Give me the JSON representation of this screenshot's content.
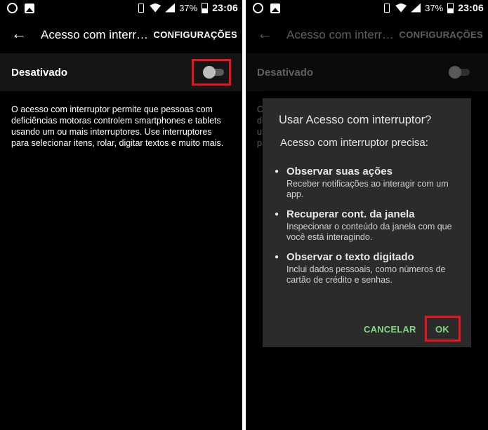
{
  "status_bar": {
    "battery": "37%",
    "time": "23:06"
  },
  "app_bar": {
    "title": "Acesso com interr…",
    "action": "CONFIGURAÇÕES"
  },
  "switch": {
    "label": "Desativado"
  },
  "description": "O acesso com interruptor permite que pessoas com deficiências motoras controlem smartphones e tablets usando um ou mais interruptores. Use interruptores para selecionar itens, rolar, digitar textos e muito mais.",
  "dialog": {
    "title": "Usar Acesso com interruptor?",
    "subtitle": "Acesso com interruptor precisa:",
    "permissions": [
      {
        "title": "Observar suas ações",
        "desc": "Receber notificações ao interagir com um app."
      },
      {
        "title": "Recuperar cont. da janela",
        "desc": "Inspecionar o conteúdo da janela com que você está interagindo."
      },
      {
        "title": "Observar o texto digitado",
        "desc": "Inclui dados pessoais, como números de cartão de crédito e senhas."
      }
    ],
    "cancel_label": "CANCELAR",
    "ok_label": "OK"
  },
  "colors": {
    "highlight": "#e8131d",
    "dialog_button": "#7fd97f",
    "dialog_background": "#2b2b2b"
  },
  "icons": [
    "circle-icon",
    "image-icon",
    "vibrate-icon",
    "wifi-icon",
    "signal-icon",
    "battery-icon",
    "back-arrow-icon",
    "bullet-icon"
  ]
}
